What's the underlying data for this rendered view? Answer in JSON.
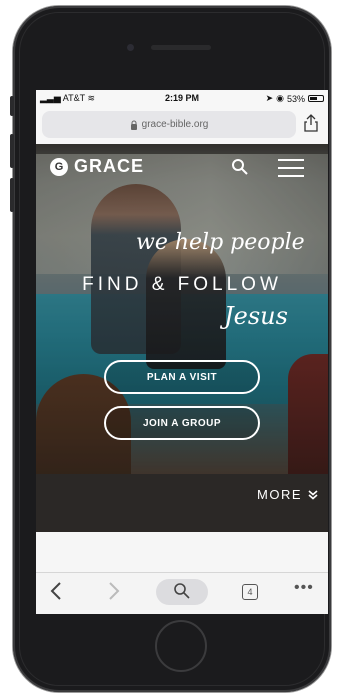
{
  "status_bar": {
    "carrier": "AT&T",
    "time": "2:19 PM",
    "battery": "53%"
  },
  "browser": {
    "url": "grace-bible.org",
    "tab_count": "4"
  },
  "site": {
    "logo_letter": "G",
    "logo_text": "GRACE",
    "tagline_script": "we help people",
    "tagline_main": "FIND & FOLLOW",
    "tagline_jesus": "Jesus",
    "cta_visit": "PLAN A VISIT",
    "cta_group": "JOIN A GROUP",
    "more_label": "MORE"
  },
  "icons": {
    "lock": "lock-icon",
    "share": "share-icon",
    "search": "search-icon",
    "menu": "hamburger-menu-icon",
    "more_chevron": "double-chevron-down-icon",
    "back": "back-chevron-icon",
    "forward": "forward-chevron-icon",
    "find": "magnifier-icon",
    "tabs": "tabs-icon",
    "overflow": "ellipsis-icon"
  }
}
